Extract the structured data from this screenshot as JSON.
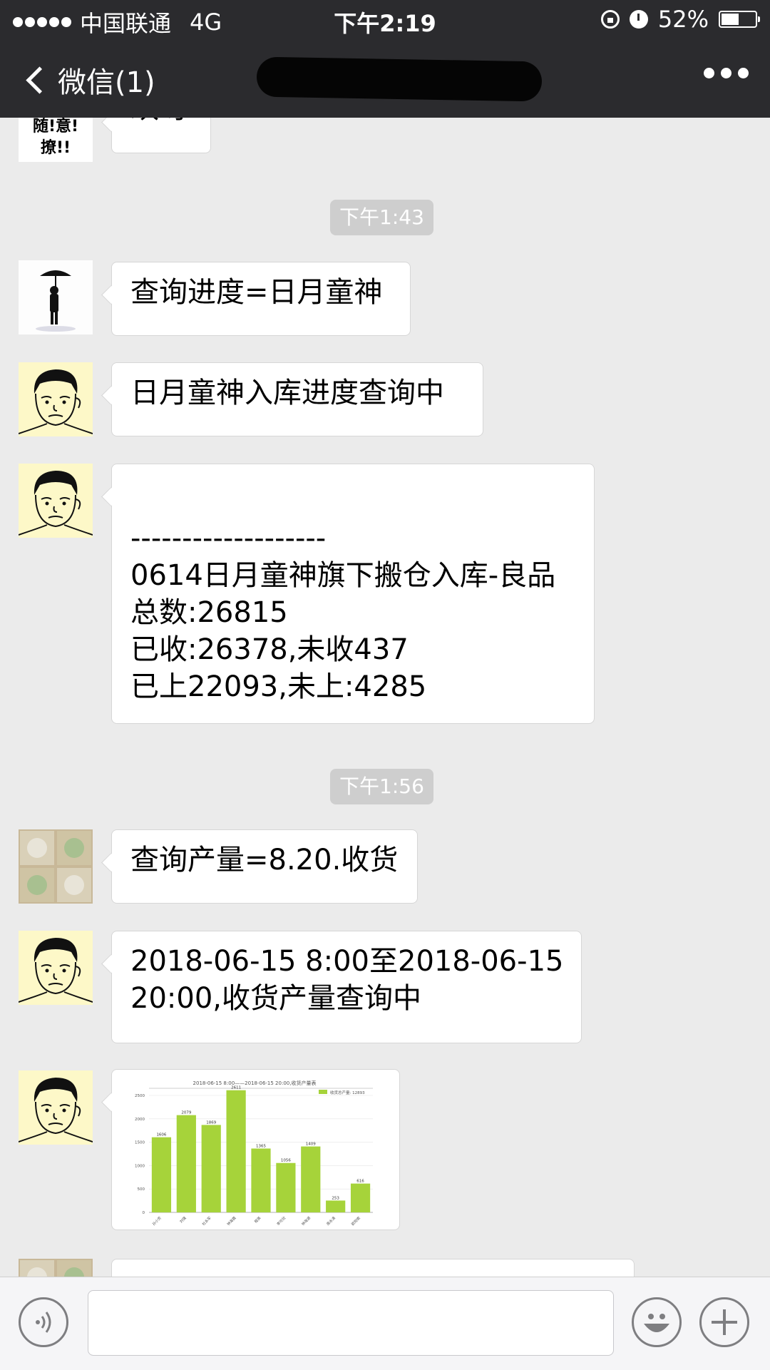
{
  "status_bar": {
    "carrier": "中国联通",
    "network": "4G",
    "time": "下午2:19",
    "battery_percent": 52,
    "battery_label": "52%",
    "icons": [
      "signal-dots-icon",
      "orientation-lock-icon",
      "alarm-icon",
      "battery-icon"
    ]
  },
  "nav_bar": {
    "back_label": "微信(1)",
    "title": "",
    "more_icon": "ellipsis-icon"
  },
  "messages": {
    "m0": {
      "avatar_text": "随!意!撩!!",
      "text": "欢呀"
    },
    "ts1": "下午1:43",
    "m1": {
      "avatar": "umbrella-person-avatar",
      "text": "查询进度=日月童神"
    },
    "m2": {
      "avatar": "cartoon-face-avatar",
      "text": "日月童神入库进度查询中"
    },
    "m3": {
      "avatar": "cartoon-face-avatar",
      "lines": [
        "",
        "-------------------",
        "0614日月童神旗下搬仓入库-良品",
        "总数:26815",
        "已收:26378,未收437",
        "已上22093,未上:4285"
      ]
    },
    "ts2": "下午1:56",
    "m4": {
      "avatar": "pattern-avatar",
      "text": "查询产量=8.20.收货"
    },
    "m5": {
      "avatar": "cartoon-face-avatar",
      "lines": [
        "2018-06-15 8:00至2018-06-15",
        "20:00,收货产量查询中"
      ]
    },
    "m6": {
      "avatar": "cartoon-face-avatar",
      "type": "image-chart"
    }
  },
  "chart_data": {
    "type": "bar",
    "title": "2018-06-15 8:00——2018-06-15 20:00,收货产量表",
    "legend": "收货总产量: 12893",
    "categories": [
      "孙小芳",
      "刘强",
      "杜永军",
      "钟海霞",
      "程英",
      "李可欣",
      "钟海源",
      "周永清",
      "欧阳俊"
    ],
    "values": [
      1606,
      2079,
      1869,
      2611,
      1365,
      1056,
      1409,
      253,
      616
    ],
    "ylim": [
      0,
      2500
    ],
    "yticks": [
      0,
      500,
      1000,
      1500,
      2000,
      2500
    ],
    "bar_color": "#a6d33a"
  },
  "input_bar": {
    "voice_icon": "voice-icon",
    "emoji_icon": "emoji-icon",
    "plus_icon": "plus-icon"
  },
  "colors": {
    "header_bg": "#2b2b2e",
    "chat_bg": "#ebebeb",
    "bubble_bg": "#ffffff",
    "timestamp_bg": "#cecece"
  }
}
